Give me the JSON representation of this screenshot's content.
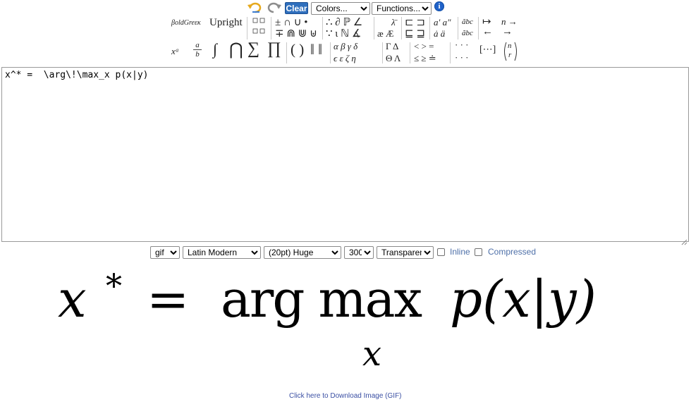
{
  "top": {
    "clear_label": "Clear",
    "colors_selected": "Colors...",
    "functions_selected": "Functions...",
    "info_glyph": "i"
  },
  "toolbar": {
    "row1": {
      "bold_greek": "βoldGreεκ",
      "upright": "Upright",
      "ops1": "± ∩ ∪ •",
      "ops2": "∴ ∂ ℙ ∠",
      "lambda_bar": "λ̄",
      "sqsub1": "⊏ ⊐",
      "primes": "a′ a″",
      "widetilde": "ãbc",
      "mapsto": "↦",
      "n_to": "n →"
    },
    "row2": {
      "ops1": "∓ ⋒ ⋓ ⊎",
      "ops2": "∵ ɩ ℕ ∡",
      "ae": "æ Æ",
      "sqsub2": "⊑ ⊒",
      "dots": "ȧ ä",
      "widehat": "ãbc",
      "leftarrow": "←",
      "rightarrow": "→"
    },
    "row3": {
      "superscript": "xᵃ",
      "frac_num": "a",
      "frac_den": "b",
      "integral": "∫",
      "bigcap": "⋂",
      "sum": "∑",
      "prod": "∏",
      "parens": "( )",
      "norms": "‖ ‖",
      "greek_top": "α  β  γ  δ",
      "greek_bot": "ϵ  ε  ζ  η",
      "cap_greek_top": "Γ  Δ",
      "cap_greek_bot": "Θ  Λ",
      "rel_top": "<  >  =",
      "rel_bot": "≤  ≥  ≐",
      "hdots": "· · ·",
      "hdots2": "· · ·",
      "matrix": "[⋯]",
      "binom_top": "n",
      "binom_bot": "r"
    }
  },
  "editor": {
    "content": "x^* =  \\arg\\!\\max_x p(x|y)"
  },
  "options": {
    "format": "gif",
    "font": "Latin Modern",
    "size": "(20pt) Huge",
    "dpi": "300",
    "background": "Transparent",
    "inline_label": "Inline",
    "compressed_label": "Compressed"
  },
  "formula": {
    "lhs": "x",
    "star": "*",
    "equals": "=",
    "operator": "arg max",
    "subscript": "x",
    "rhs": "p(x|y)"
  },
  "download_link": "Click here to Download Image (GIF)"
}
